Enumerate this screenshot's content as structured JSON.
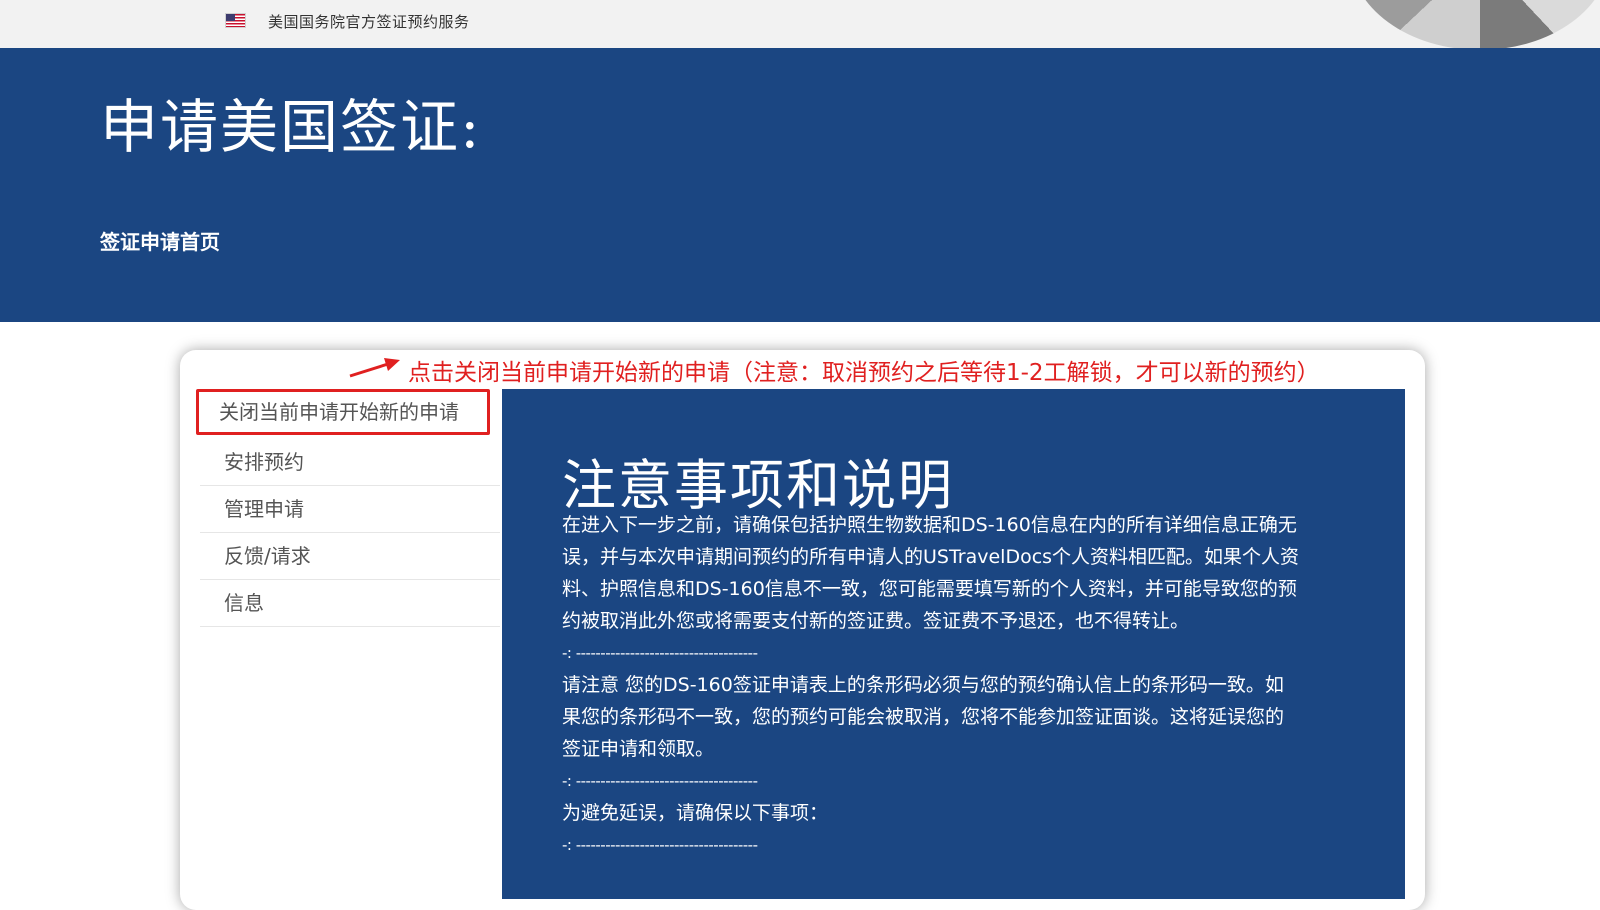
{
  "topbar": {
    "site_name": "美国国务院官方签证预约服务",
    "flag_icon": "us-flag-icon"
  },
  "header": {
    "title": "申请美国签证:",
    "breadcrumb": "签证申请首页"
  },
  "annotation": {
    "text": "点击关闭当前申请开始新的申请（注意：取消预约之后等待1-2工解锁，才可以新的预约）",
    "color": "#e02020"
  },
  "sidebar": {
    "items": [
      {
        "label": "关闭当前申请开始新的申请"
      },
      {
        "label": "安排预约"
      },
      {
        "label": "管理申请"
      },
      {
        "label": "反馈/请求"
      },
      {
        "label": "信息"
      }
    ]
  },
  "main": {
    "title": "注意事项和说明",
    "paragraph1": "在进入下一步之前，请确保包括护照生物数据和DS-160信息在内的所有详细信息正确无误，并与本次申请期间预约的所有申请人的USTravelDocs个人资料相匹配。如果个人资料、护照信息和DS-160信息不一致，您可能需要填写新的个人资料，并可能导致您的预约被取消此外您或将需要支付新的签证费。签证费不予退还，也不得转让。",
    "divider1": "-: -------------------------------------",
    "paragraph2": "请注意 您的DS-160签证申请表上的条形码必须与您的预约确认信上的条形码一致。如果您的条形码不一致，您的预约可能会被取消，您将不能参加签证面谈。这将延误您的签证申请和领取。",
    "divider2": "-: -------------------------------------",
    "paragraph3": "为避免延误，请确保以下事项：",
    "divider3": "-: -------------------------------------"
  },
  "colors": {
    "header_blue": "#1b4682",
    "annotation_red": "#e02020"
  }
}
